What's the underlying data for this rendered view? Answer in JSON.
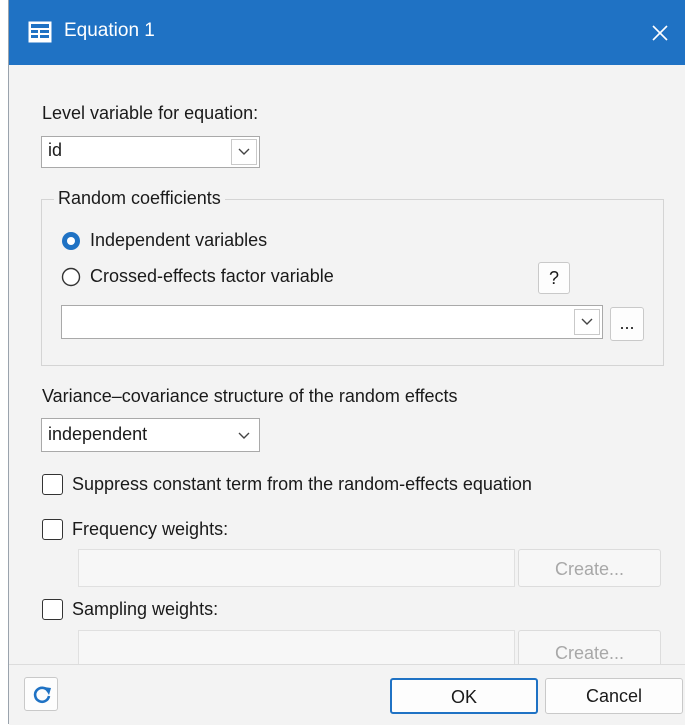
{
  "window": {
    "title": "Equation 1",
    "close_icon": "close-icon",
    "title_icon": "table-icon",
    "accent_color": "#1f72c4"
  },
  "level": {
    "label": "Level variable for equation:",
    "value": "id"
  },
  "random_coefficients": {
    "group_title": "Random coefficients",
    "option_independent": "Independent variables",
    "option_crossed": "Crossed-effects factor variable",
    "selected": "Independent variables",
    "help_label": "?",
    "factor_value": "",
    "browse_label": "..."
  },
  "covariance": {
    "label": "Variance–covariance structure of the random effects",
    "value": "independent"
  },
  "suppress_constant": {
    "label": "Suppress constant term from the random-effects equation",
    "checked": false
  },
  "frequency_weights": {
    "label": "Frequency weights:",
    "checked": false,
    "create_label": "Create..."
  },
  "sampling_weights": {
    "label": "Sampling weights:",
    "checked": false,
    "create_label": "Create..."
  },
  "footer": {
    "reset_icon": "refresh-icon",
    "ok_label": "OK",
    "cancel_label": "Cancel"
  }
}
